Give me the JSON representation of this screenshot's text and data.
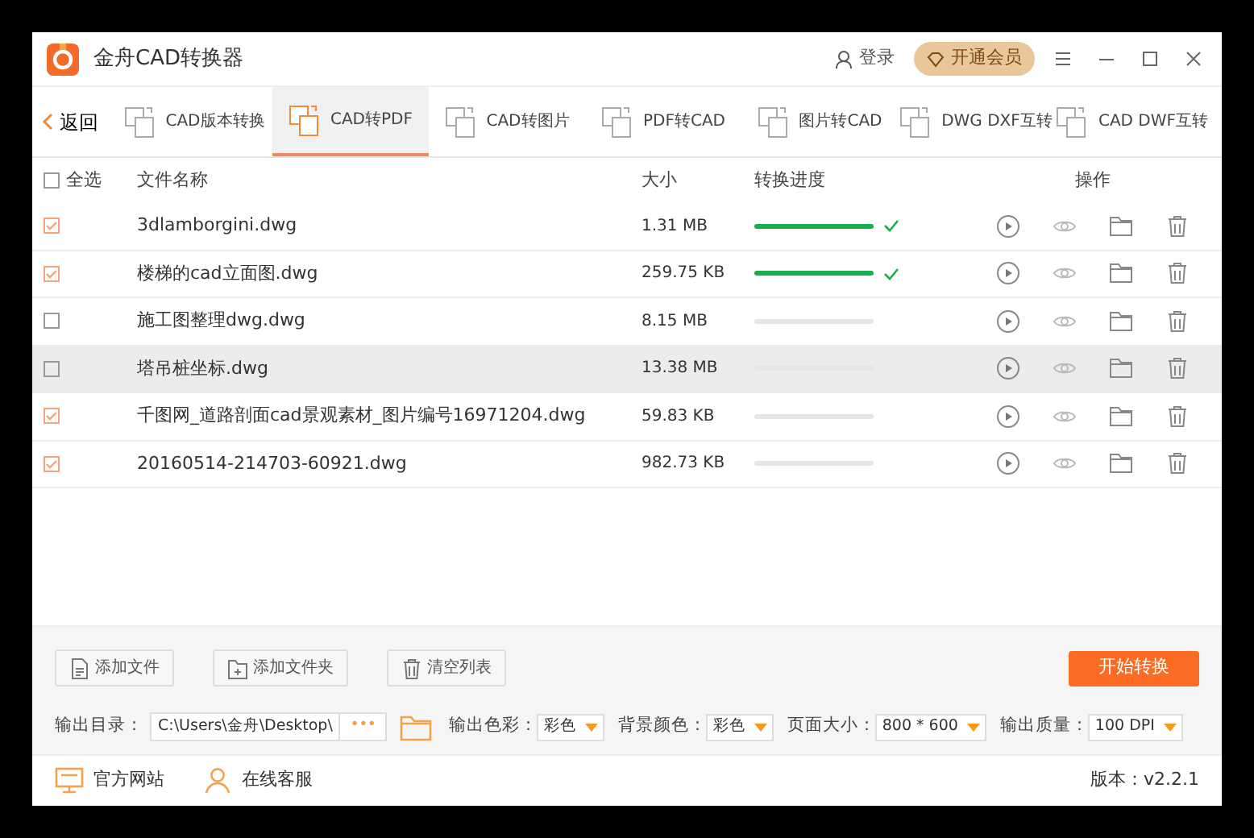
{
  "window": {
    "title": "金舟CAD转换器",
    "login": "登录",
    "vip": "开通会员"
  },
  "back": "返回",
  "tabs": [
    {
      "label": "CAD版本转换",
      "selected": false
    },
    {
      "label": "CAD转PDF",
      "selected": true
    },
    {
      "label": "CAD转图片",
      "selected": false
    },
    {
      "label": "PDF转CAD",
      "selected": false
    },
    {
      "label": "图片转CAD",
      "selected": false
    },
    {
      "label": "DWG DXF互转",
      "selected": false
    },
    {
      "label": "CAD DWF互转",
      "selected": false
    }
  ],
  "table": {
    "select_all": {
      "label": "全选",
      "checked": false
    },
    "columns": [
      "文件名称",
      "大小",
      "转换进度",
      "操作"
    ],
    "rows": [
      {
        "checked": true,
        "name": "3dlamborgini.dwg",
        "size": "1.31 MB",
        "level": 1,
        "done": true,
        "selected": false
      },
      {
        "checked": true,
        "name": "楼梯的cad立面图.dwg",
        "size": "259.75 KB",
        "level": 1,
        "done": true,
        "selected": false
      },
      {
        "checked": false,
        "name": "施工图整理dwg.dwg",
        "size": "8.15 MB",
        "level": 0,
        "done": false,
        "selected": false
      },
      {
        "checked": false,
        "name": "塔吊桩坐标.dwg",
        "size": "13.38 MB",
        "level": 0,
        "done": false,
        "selected": true
      },
      {
        "checked": true,
        "name": "千图网_道路剖面cad景观素材_图片编号16971204.dwg",
        "size": "59.83 KB",
        "level": 0,
        "done": false,
        "selected": false
      },
      {
        "checked": true,
        "name": "20160514-214703-60921.dwg",
        "size": "982.73 KB",
        "level": 0,
        "done": false,
        "selected": false
      }
    ]
  },
  "actions": [
    {
      "kind": "file",
      "label": "添加文件"
    },
    {
      "kind": "folder",
      "label": "添加文件夹"
    },
    {
      "kind": "trash",
      "label": "清空列表"
    }
  ],
  "start_button": "开始转换",
  "output_dir": {
    "label": "输出目录：",
    "value": "C:\\Users\\金舟\\Desktop\\",
    "more": "•••"
  },
  "options": [
    {
      "label": "输出色彩：",
      "value": "彩色"
    },
    {
      "label": "背景颜色：",
      "value": "彩色"
    },
    {
      "label": "页面大小：",
      "value": "800 * 600"
    },
    {
      "label": "输出质量：",
      "value": "100 DPI"
    }
  ],
  "footer": {
    "links": [
      {
        "kind": "monitor",
        "label": "官方网站"
      },
      {
        "kind": "person",
        "label": "在线客服"
      }
    ],
    "version": "版本：v2.2.1"
  }
}
